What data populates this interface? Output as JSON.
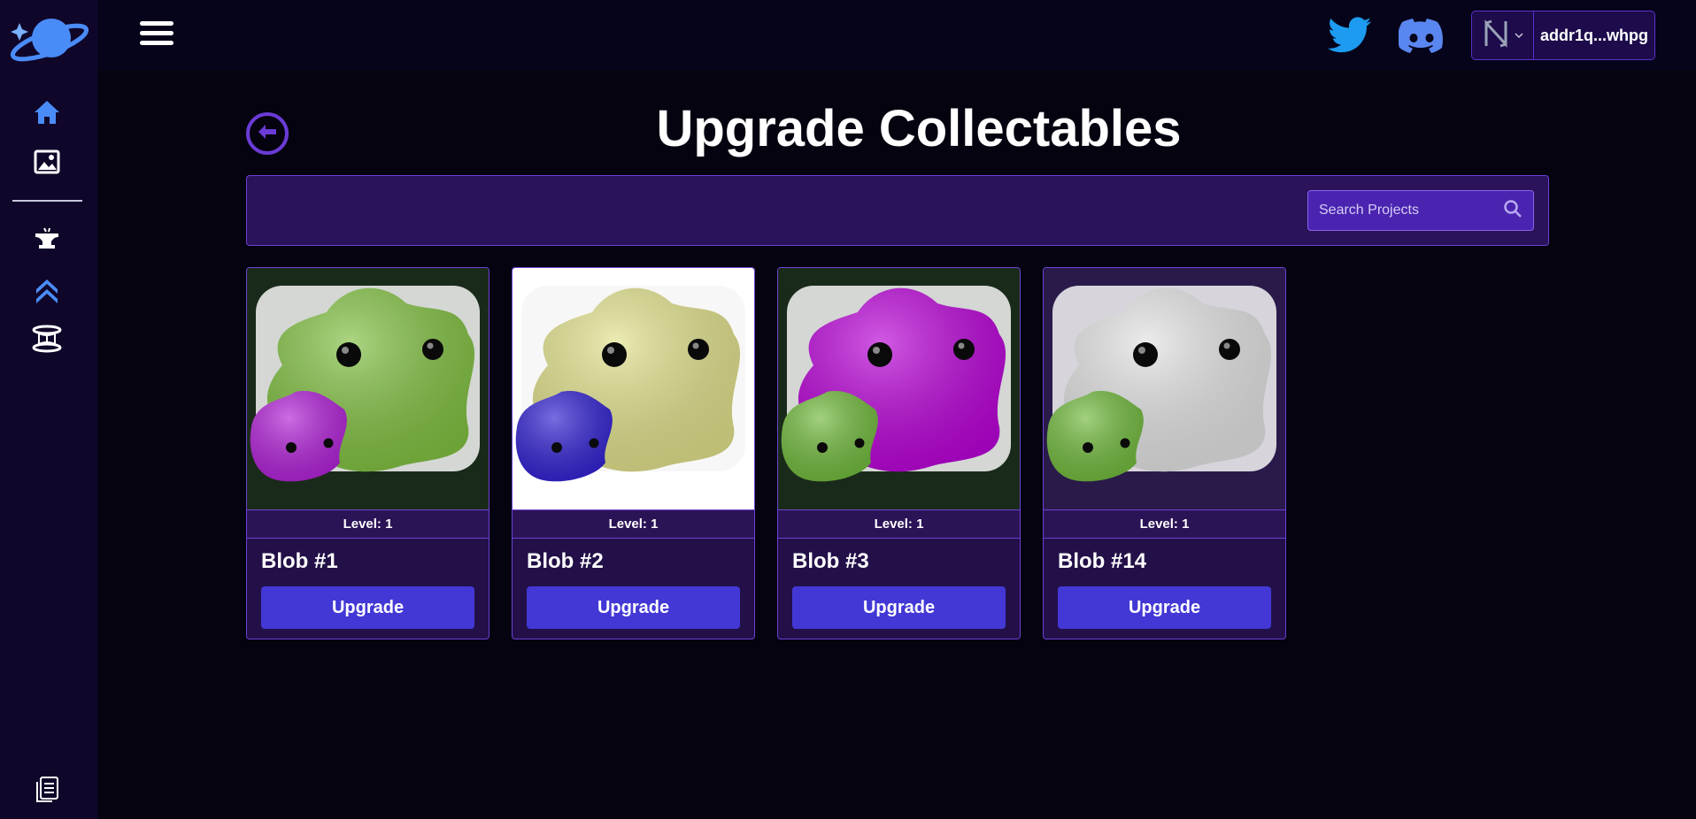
{
  "header": {
    "wallet_address": "addr1q...whpg"
  },
  "page": {
    "title": "Upgrade Collectables"
  },
  "search": {
    "placeholder": "Search Projects"
  },
  "cards": [
    {
      "name": "Blob #1",
      "level": "Level: 1",
      "button": "Upgrade",
      "main_color": "#7fbf3f",
      "small_color": "#b01fd6",
      "bg": "#1a2a1a"
    },
    {
      "name": "Blob #2",
      "level": "Level: 1",
      "button": "Upgrade",
      "main_color": "#e0e08a",
      "small_color": "#2f1fd0",
      "bg": "#ffffff"
    },
    {
      "name": "Blob #3",
      "level": "Level: 1",
      "button": "Upgrade",
      "main_color": "#b800d6",
      "small_color": "#6fb83a",
      "bg": "#1a2a1a"
    },
    {
      "name": "Blob #14",
      "level": "Level: 1",
      "button": "Upgrade",
      "main_color": "#e2e2e2",
      "small_color": "#6fb83a",
      "bg": "#2a1a4a"
    }
  ],
  "colors": {
    "accent": "#6b41d6",
    "button": "#4338d6",
    "panel": "#2a1359",
    "twitter": "#1d9bf0",
    "discord": "#5865f2",
    "icon_blue": "#4a8cf7"
  }
}
